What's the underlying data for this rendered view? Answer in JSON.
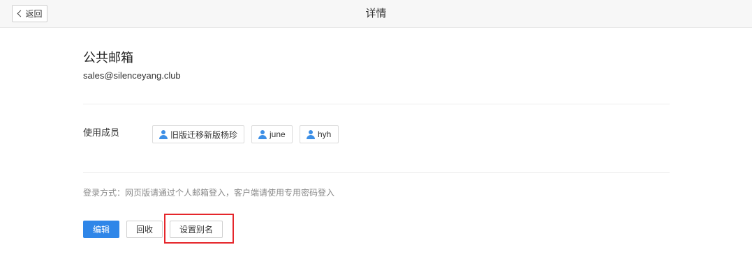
{
  "header": {
    "back_label": "返回",
    "title": "详情"
  },
  "mailbox": {
    "name": "公共邮箱",
    "address": "sales@silenceyang.club"
  },
  "members": {
    "label": "使用成员",
    "items": [
      {
        "name": "旧版迁移新版杨珍",
        "icon": "user-icon"
      },
      {
        "name": "june",
        "icon": "user-icon"
      },
      {
        "name": "hyh",
        "icon": "user-icon"
      }
    ]
  },
  "login_info": "登录方式：网页版请通过个人邮箱登入，客户端请使用专用密码登入",
  "actions": {
    "edit_label": "编辑",
    "recycle_label": "回收",
    "alias_label": "设置别名"
  },
  "colors": {
    "primary": "#2f86e8",
    "highlight": "#e5262b",
    "icon": "#3d8fe6"
  }
}
